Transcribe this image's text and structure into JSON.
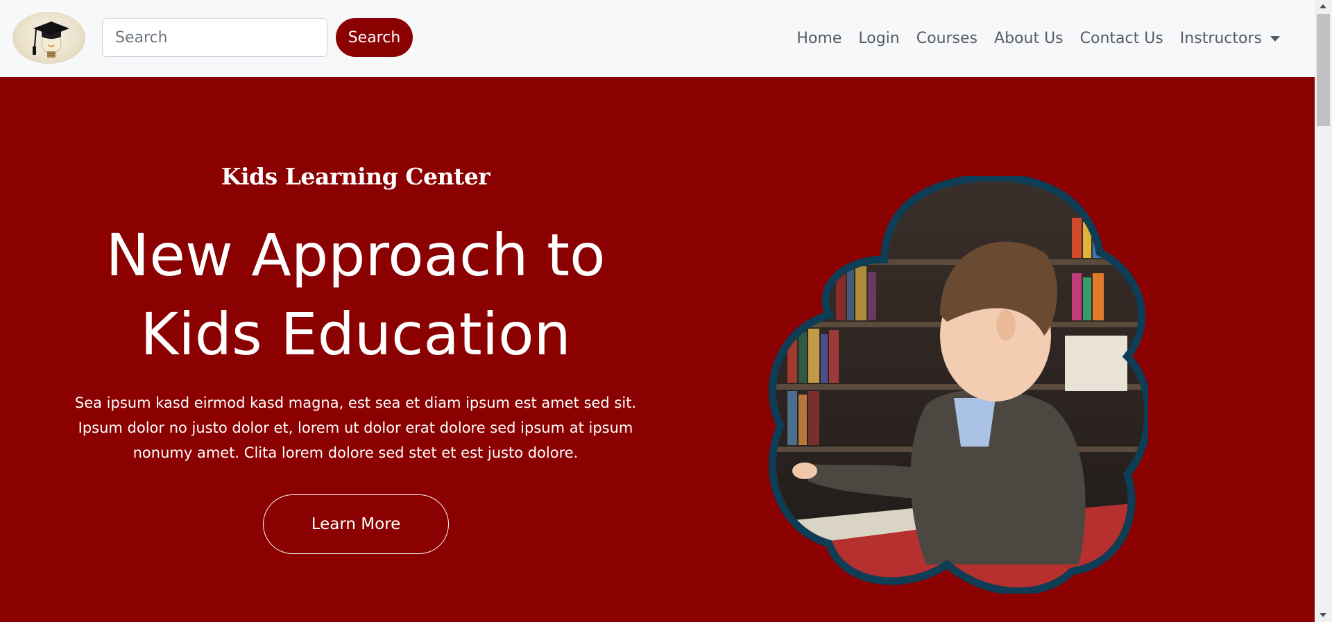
{
  "navbar": {
    "logo_icon": "graduation-cap-lightbulb-icon",
    "search": {
      "placeholder": "Search",
      "value": "",
      "button_label": "Search"
    },
    "links": [
      {
        "label": "Home"
      },
      {
        "label": "Login"
      },
      {
        "label": "Courses"
      },
      {
        "label": "About Us"
      },
      {
        "label": "Contact Us"
      },
      {
        "label": "Instructors",
        "dropdown": true
      }
    ]
  },
  "hero": {
    "eyebrow": "Kids Learning Center",
    "headline_line1": "New Approach to",
    "headline_line2": "Kids Education",
    "lead_line1": "Sea ipsum kasd eirmod kasd magna, est sea et diam ipsum est amet sed sit.",
    "lead_line2": "Ipsum dolor no justo dolor et, lorem ut dolor erat dolore sed ipsum at ipsum",
    "lead_line3": "nonumy amet. Clita lorem dolore sed stet et est justo dolore.",
    "button_label": "Learn More",
    "image_icon": "boy-reading-book-photo"
  },
  "colors": {
    "brand": "#8b0000",
    "navbar_bg": "#f7f8fa",
    "nav_text": "#555b61",
    "image_border": "#0f3d55"
  }
}
